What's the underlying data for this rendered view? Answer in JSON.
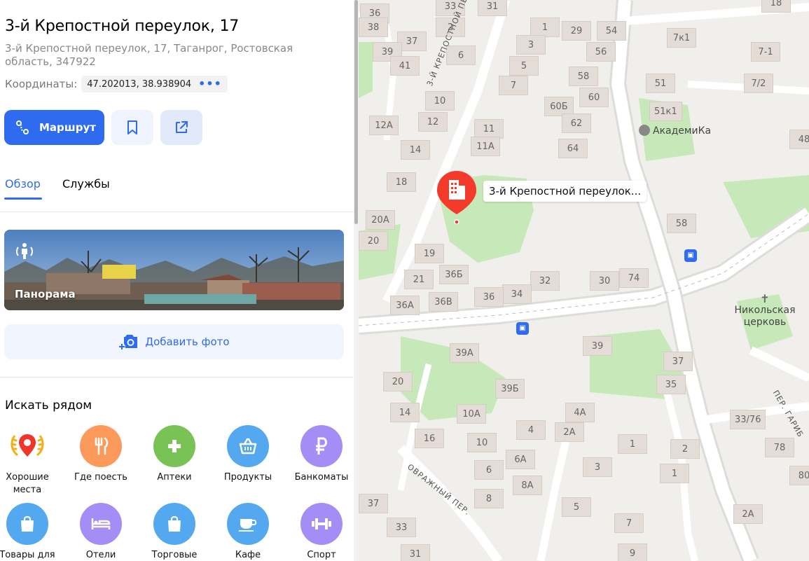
{
  "place": {
    "title": "3-й Крепостной переулок, 17",
    "address": "3-й Крепостной переулок, 17, Таганрог, Ростовская область, 347922",
    "coords_label": "Координаты:",
    "coords_value": "47.202013, 38.938904",
    "more_icon": "dots-icon"
  },
  "actions": {
    "route_label": "Маршрут",
    "route_icon": "route-icon",
    "bookmark_icon": "bookmark-icon",
    "share_icon": "share-icon"
  },
  "tabs": [
    {
      "label": "Обзор",
      "active": true
    },
    {
      "label": "Службы",
      "active": false
    }
  ],
  "panorama": {
    "label": "Панорама",
    "icon": "panorama-icon"
  },
  "add_photo": {
    "label": "Добавить фото",
    "icon": "camera-plus-icon"
  },
  "nearby": {
    "title": "Искать рядом",
    "items": [
      {
        "label": "Хорошие места",
        "icon": "laurel-pin-icon",
        "color": "#ffffff"
      },
      {
        "label": "Где поесть",
        "icon": "fork-knife-icon",
        "color": "#fb9a5b"
      },
      {
        "label": "Аптеки",
        "icon": "plus-icon",
        "color": "#79c255"
      },
      {
        "label": "Продукты",
        "icon": "basket-icon",
        "color": "#53a8ef"
      },
      {
        "label": "Банкоматы",
        "icon": "ruble-icon",
        "color": "#a58df6"
      },
      {
        "label": "Товары для",
        "icon": "shopping-bag-icon",
        "color": "#53a8ef"
      },
      {
        "label": "Отели",
        "icon": "bed-icon",
        "color": "#a58df6"
      },
      {
        "label": "Торговые",
        "icon": "shopping-bag-icon",
        "color": "#53a8ef"
      },
      {
        "label": "Кафе",
        "icon": "cup-icon",
        "color": "#53a8ef"
      },
      {
        "label": "Спорт",
        "icon": "dumbbell-icon",
        "color": "#a58df6"
      }
    ]
  },
  "map": {
    "pin_label": "3-й Крепостной переулок...",
    "pin_color": "#f33a2b",
    "streets": [
      "3-Й КРЕПОСТНОЙ ПЕР.",
      "ОВРАЖНЫЙ ПЕР.",
      "ПЕР. ГАРИБ"
    ],
    "poi": [
      "АкадемиКа",
      "Никольская церковь"
    ],
    "house_numbers": [
      "36",
      "33",
      "31",
      "2",
      "1",
      "29",
      "54",
      "18",
      "38",
      "37",
      "6",
      "3",
      "56",
      "7к1",
      "7-1",
      "39",
      "41",
      "5",
      "58",
      "51",
      "7/2",
      "7",
      "60",
      "10",
      "60Б",
      "51к1",
      "12А",
      "12",
      "11",
      "62",
      "48",
      "14",
      "11А",
      "64",
      "18",
      "20А",
      "58",
      "20",
      "19",
      "36Б",
      "32",
      "30",
      "74",
      "21",
      "34",
      "36",
      "36А",
      "36В",
      "39А",
      "39",
      "37",
      "39Б",
      "35",
      "20",
      "14",
      "10А",
      "4А",
      "33/76",
      "4",
      "2А",
      "16",
      "10",
      "1",
      "2",
      "78",
      "6А",
      "3",
      "6",
      "1",
      "80",
      "8А",
      "8",
      "5",
      "37",
      "7",
      "2А",
      "33",
      "9",
      "31"
    ]
  }
}
